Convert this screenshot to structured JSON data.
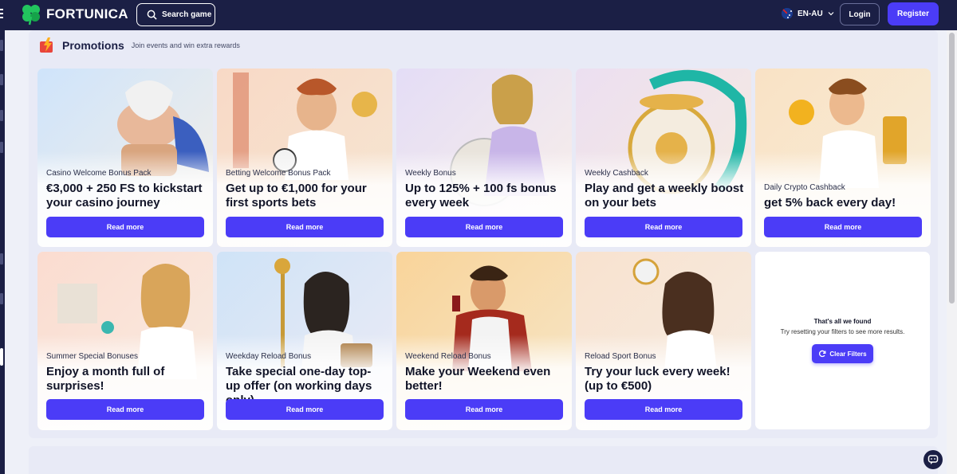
{
  "header": {
    "brand": "FORTUNICA",
    "search_label": "Search game",
    "language": "EN-AU",
    "login_label": "Login",
    "register_label": "Register"
  },
  "promotions": {
    "title": "Promotions",
    "subtitle": "Join events and win extra rewards"
  },
  "cards": [
    {
      "tag": "Casino Welcome Bonus Pack",
      "title": "€3,000 + 250 FS to kickstart your casino journey",
      "button": "Read more"
    },
    {
      "tag": "Betting Welcome Bonus Pack",
      "title": "Get up to €1,000 for your first sports bets",
      "button": "Read more"
    },
    {
      "tag": "Weekly Bonus",
      "title": "Up to 125% + 100 fs bonus every week",
      "button": "Read more"
    },
    {
      "tag": "Weekly Cashback",
      "title": "Play and get a weekly boost on your bets",
      "button": "Read more"
    },
    {
      "tag": "Daily Crypto Cashback",
      "title": "get 5% back every day!",
      "button": "Read more"
    },
    {
      "tag": "Summer Special Bonuses",
      "title": "Enjoy a month full of surprises!",
      "button": "Read more"
    },
    {
      "tag": "Weekday Reload Bonus",
      "title": "Take special one-day top-up offer (on working days only)",
      "button": "Read more"
    },
    {
      "tag": "Weekend Reload Bonus",
      "title": "Make your Weekend even better!",
      "button": "Read more"
    },
    {
      "tag": "Reload Sport Bonus",
      "title": "Try your luck every week! (up to €500)",
      "button": "Read more"
    }
  ],
  "empty_state": {
    "title": "That's all we found",
    "subtitle": "Try resetting your filters to see more results.",
    "button": "Clear Filters"
  },
  "colors": {
    "header_bg": "#1b1f45",
    "accent": "#4b3cf7",
    "brand_green": "#22c55e"
  },
  "icons": [
    "menu-icon",
    "clover-logo-icon",
    "search-icon",
    "flag-au-icon",
    "chevron-down-icon",
    "promotions-icon",
    "refresh-icon",
    "chat-icon"
  ]
}
